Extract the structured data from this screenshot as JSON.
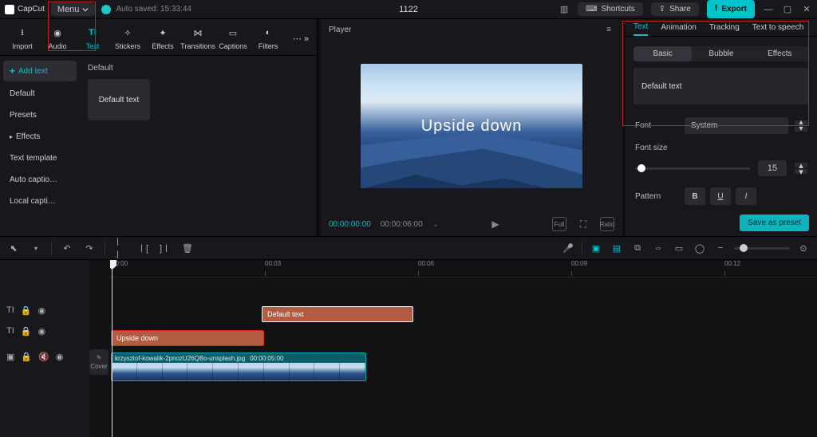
{
  "app": {
    "name": "CapCut",
    "project_title": "1122",
    "autosave": "Auto saved: 15:33:44",
    "menu_label": "Menu"
  },
  "topbar": {
    "shortcuts": "Shortcuts",
    "share": "Share",
    "export": "Export"
  },
  "asset_tabs": {
    "import": "Import",
    "audio": "Audio",
    "text": "Text",
    "stickers": "Stickers",
    "effects": "Effects",
    "transitions": "Transitions",
    "captions": "Captions",
    "filters": "Filters"
  },
  "text_side": {
    "add_text": "Add text",
    "default": "Default",
    "presets": "Presets",
    "effects": "Effects",
    "text_template": "Text template",
    "auto_captions": "Auto captio…",
    "local_captions": "Local capti…"
  },
  "assets_grid": {
    "section": "Default",
    "thumb": "Default text"
  },
  "player": {
    "title": "Player",
    "overlay_text": "Upside down",
    "time_current": "00:00:00:00",
    "time_total": "00:00:06:00",
    "full_btn": "Full",
    "ratio_btn": "Ratio"
  },
  "inspector": {
    "tabs": {
      "text": "Text",
      "animation": "Animation",
      "tracking": "Tracking",
      "tts": "Text to speech"
    },
    "subtabs": {
      "basic": "Basic",
      "bubble": "Bubble",
      "effects": "Effects"
    },
    "text_value": "Default text",
    "font_label": "Font",
    "font_value": "System",
    "fontsize_label": "Font size",
    "fontsize_value": "15",
    "pattern_label": "Pattern",
    "save_preset": "Save as preset"
  },
  "timeline": {
    "ruler": {
      "t0": "00:00",
      "t1": "00:03",
      "t2": "00:06",
      "t3": "00:09",
      "t4": "00:12"
    },
    "clip_default": "Default text",
    "clip_upside": "Upside down",
    "video_name": "krzysztof-kowalik-2pnozU26QBo-unsplash.jpg",
    "video_dur": "00:00:05:00",
    "cover": "Cover"
  }
}
